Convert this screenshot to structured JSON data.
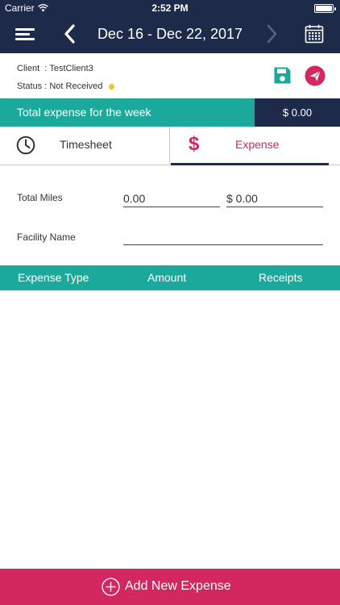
{
  "status_bar": {
    "carrier": "Carrier",
    "time": "2:52 PM"
  },
  "nav": {
    "title": "Dec 16 - Dec 22, 2017"
  },
  "info": {
    "client_label": "Client",
    "client_value": "TestClient3",
    "status_label": "Status",
    "status_value": "Not Received",
    "status_color": "#f2c320"
  },
  "banner": {
    "label": "Total expense for the week",
    "amount": "$ 0.00"
  },
  "tabs": [
    {
      "label": "Timesheet",
      "icon": "clock-icon",
      "selected": false
    },
    {
      "label": "Expense",
      "icon": "dollar-icon",
      "selected": true
    }
  ],
  "form": {
    "total_miles_label": "Total Miles",
    "miles_value": "0.00",
    "miles_amount": "$ 0.00",
    "facility_label": "Facility Name",
    "facility_value": ""
  },
  "table": {
    "columns": [
      "Expense Type",
      "Amount",
      "Receipts"
    ],
    "rows": []
  },
  "add_button": {
    "label": "Add New Expense"
  },
  "colors": {
    "navy": "#1e2a4a",
    "teal": "#1aa99a",
    "accent": "#d32760"
  }
}
